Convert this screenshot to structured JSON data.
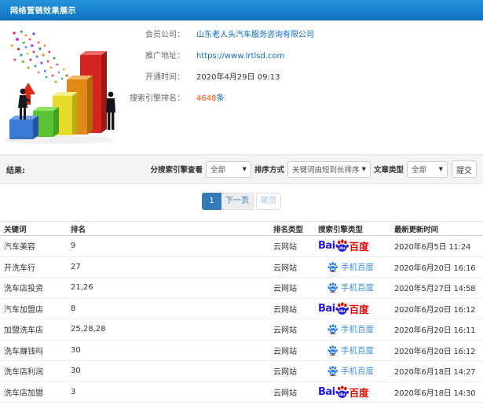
{
  "header": {
    "title": "网络营销效果展示"
  },
  "illustration": {
    "name": "growth-bar-chart-illustration"
  },
  "info": {
    "fields": [
      {
        "label": "会员公司：",
        "value": "山东老人头汽车服务咨询有限公司",
        "type": "link"
      },
      {
        "label": "推广地址：",
        "value": "https://www.lrtlsd.com",
        "type": "link"
      },
      {
        "label": "开通时间：",
        "value": "2020年4月29日 09:13",
        "type": "text"
      },
      {
        "label": "搜索引擎排名：",
        "value": "4648",
        "suffix": "条",
        "type": "count"
      }
    ]
  },
  "filters": {
    "result_label": "结果:",
    "engine_label": "分搜索引擎查看",
    "engine_value": "全部",
    "sort_label": "排序方式",
    "sort_value": "关键词由短到长排序",
    "type_label": "文章类型",
    "type_value": "全部",
    "submit_label": "提交"
  },
  "pagination": {
    "current": "1",
    "next": "下一页",
    "last": "尾页"
  },
  "table": {
    "headers": [
      "关键词",
      "排名",
      "排名类型",
      "搜索引擎类型",
      "最新更新时间"
    ],
    "baidu_logo": {
      "latin": "Bai",
      "paw_text": "du",
      "cn": "百度"
    },
    "rows": [
      {
        "keyword": "汽车美容",
        "rank": "9",
        "rank_type": "云网站",
        "engine": "baidu",
        "engine_label": "百度",
        "updated": "2020年6月5日 11:24"
      },
      {
        "keyword": "开洗车行",
        "rank": "27",
        "rank_type": "云网站",
        "engine": "mobile-baidu",
        "engine_label": "手机百度",
        "updated": "2020年6月20日 16:16"
      },
      {
        "keyword": "洗车店投资",
        "rank": "21,26",
        "rank_type": "云网站",
        "engine": "mobile-baidu",
        "engine_label": "手机百度",
        "updated": "2020年5月27日 14:58"
      },
      {
        "keyword": "汽车加盟店",
        "rank": "8",
        "rank_type": "云网站",
        "engine": "baidu",
        "engine_label": "百度",
        "updated": "2020年6月20日 16:12"
      },
      {
        "keyword": "加盟洗车店",
        "rank": "25,28,28",
        "rank_type": "云网站",
        "engine": "mobile-baidu",
        "engine_label": "手机百度",
        "updated": "2020年6月20日 16:11"
      },
      {
        "keyword": "洗车赚钱吗",
        "rank": "30",
        "rank_type": "云网站",
        "engine": "mobile-baidu",
        "engine_label": "手机百度",
        "updated": "2020年6月20日 16:12"
      },
      {
        "keyword": "洗车店利润",
        "rank": "30",
        "rank_type": "云网站",
        "engine": "mobile-baidu",
        "engine_label": "手机百度",
        "updated": "2020年6月18日 14:27"
      },
      {
        "keyword": "洗车店加盟",
        "rank": "3",
        "rank_type": "云网站",
        "engine": "baidu",
        "engine_label": "百度",
        "updated": "2020年6月18日 14:30"
      }
    ]
  }
}
